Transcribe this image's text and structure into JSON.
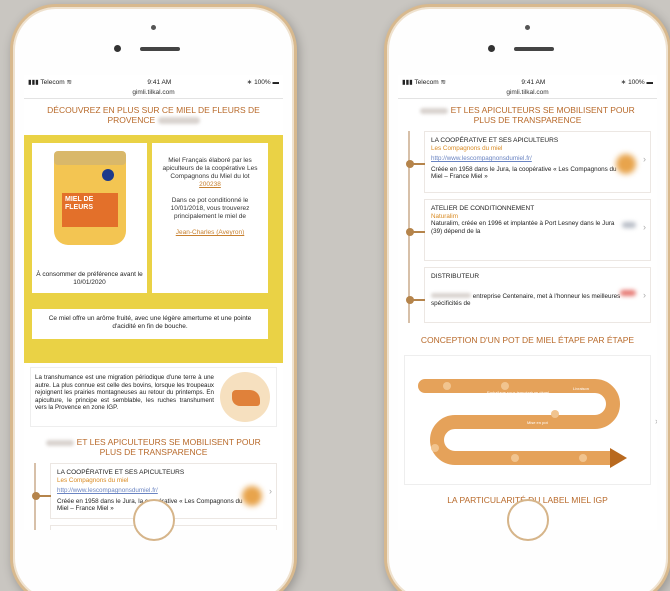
{
  "status": {
    "carrier": "Telecom",
    "time": "9:41 AM",
    "battery": "100%"
  },
  "url": "gimli.tilkal.com",
  "left": {
    "title": "DÉCOUVREZ EN PLUS SUR CE MIEL DE FLEURS DE PROVENCE",
    "jar_label": "MIEL DE FLEURS",
    "consume": "À consommer de préférence avant le 10/01/2020",
    "info1": "Miel Français élaboré par les apiculteurs de la coopérative Les Compagnons du Miel du lot",
    "lot": "200238",
    "info2": "Dans ce pot conditionné le 10/01/2018, vous trouverez principalement le miel de",
    "beekeeper": "Jean-Charles (Aveyron)",
    "taste": "Ce miel offre un arôme fruité, avec une légère amertume et une pointe d'acidité en fin de bouche.",
    "transhumance": "La transhumance est une migration périodique d'une terre à une autre. La plus connue est celle des bovins, lorsque les troupeaux rejoignent les prairies montagneuses au retour du printemps. En apiculture, le principe est semblable, les ruches transhument vers la Provence en zone IGP.",
    "mobilise": "ET LES APICULTEURS SE MOBILISENT POUR PLUS DE TRANSPARENCE",
    "card": {
      "title": "LA COOPÉRATIVE ET SES APICULTEURS",
      "sub": "Les Compagnons du miel",
      "link": "http://www.lescompagnonsdumiel.fr/",
      "text": "Créée en 1958 dans le Jura, la coopérative « Les Compagnons du Miel – France Miel »"
    }
  },
  "right": {
    "title": "ET LES APICULTEURS SE MOBILISENT POUR PLUS DE TRANSPARENCE",
    "cards": [
      {
        "title": "LA COOPÉRATIVE ET SES APICULTEURS",
        "sub": "Les Compagnons du miel",
        "link": "http://www.lescompagnonsdumiel.fr/",
        "text": "Créée en 1958 dans le Jura, la coopérative « Les Compagnons du Miel – France Miel »"
      },
      {
        "title": "ATELIER DE CONDITIONNEMENT",
        "sub": "Naturalim",
        "link": "",
        "text": "Naturalim, créée en 1996 et implantée à Port Lesney dans le Jura (39) dépend de la"
      },
      {
        "title": "DISTRIBUTEUR",
        "sub": "",
        "link": "",
        "text": "entreprise Centenaire, met à l'honneur les meilleures spécificités de"
      }
    ],
    "conception": "CONCEPTION D'UN POT DE MIEL ÉTAPE PAR ÉTAPE",
    "steps": [
      "Récolte",
      "Emballage sous température dégel",
      "Livraison",
      "Mise en pot",
      "Présentation en magasin",
      "Dégustation"
    ],
    "label_igp": "LA PARTICULARITÉ DU LABEL MIEL IGP"
  },
  "colors": {
    "accent": "#b86a2b",
    "honey": "#ead245",
    "orange": "#e3702a",
    "gold": "#d8b98e"
  }
}
